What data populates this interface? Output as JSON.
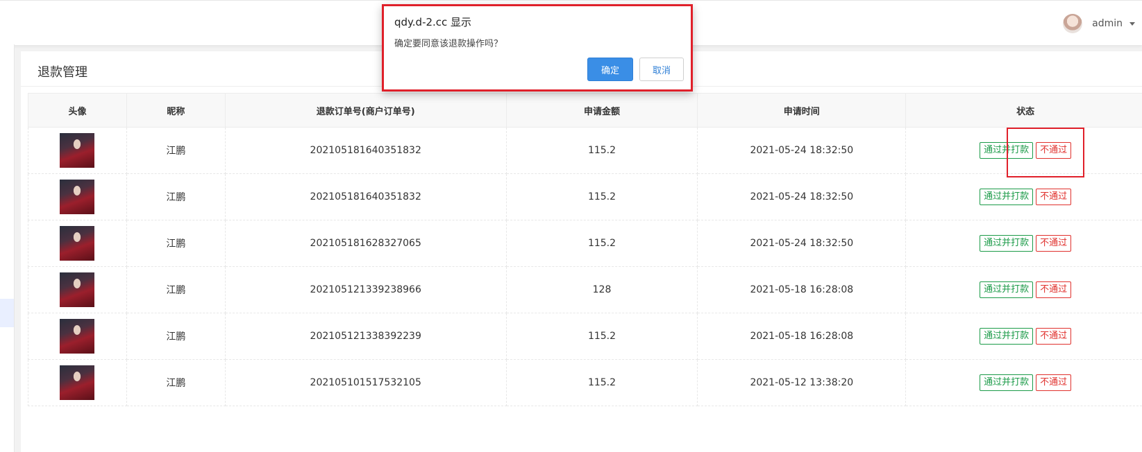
{
  "header": {
    "user_name": "admin",
    "avatar_icon": "avatar-icon",
    "dropdown_icon": "caret-down-icon"
  },
  "page": {
    "title": "退款管理"
  },
  "table": {
    "columns": [
      "头像",
      "昵称",
      "退款订单号(商户订单号)",
      "申请金额",
      "申请时间",
      "状态"
    ],
    "rows": [
      {
        "nickname": "江鹏",
        "order_no": "202105181640351832",
        "amount": "115.2",
        "time": "2021-05-24 18:32:50",
        "pass_label": "通过并打款",
        "reject_label": "不通过"
      },
      {
        "nickname": "江鹏",
        "order_no": "202105181640351832",
        "amount": "115.2",
        "time": "2021-05-24 18:32:50",
        "pass_label": "通过并打款",
        "reject_label": "不通过"
      },
      {
        "nickname": "江鹏",
        "order_no": "202105181628327065",
        "amount": "115.2",
        "time": "2021-05-24 18:32:50",
        "pass_label": "通过并打款",
        "reject_label": "不通过"
      },
      {
        "nickname": "江鹏",
        "order_no": "202105121339238966",
        "amount": "128",
        "time": "2021-05-18 16:28:08",
        "pass_label": "通过并打款",
        "reject_label": "不通过"
      },
      {
        "nickname": "江鹏",
        "order_no": "202105121338392239",
        "amount": "115.2",
        "time": "2021-05-18 16:28:08",
        "pass_label": "通过并打款",
        "reject_label": "不通过"
      },
      {
        "nickname": "江鹏",
        "order_no": "202105101517532105",
        "amount": "115.2",
        "time": "2021-05-12 13:38:20",
        "pass_label": "通过并打款",
        "reject_label": "不通过"
      }
    ]
  },
  "dialog": {
    "title": "qdy.d-2.cc 显示",
    "message": "确定要同意该退款操作吗？",
    "ok_label": "确定",
    "cancel_label": "取消"
  },
  "colors": {
    "pass": "#1a9a47",
    "reject": "#e0302c",
    "highlight": "#e0202a",
    "primary": "#3a8ee6"
  }
}
